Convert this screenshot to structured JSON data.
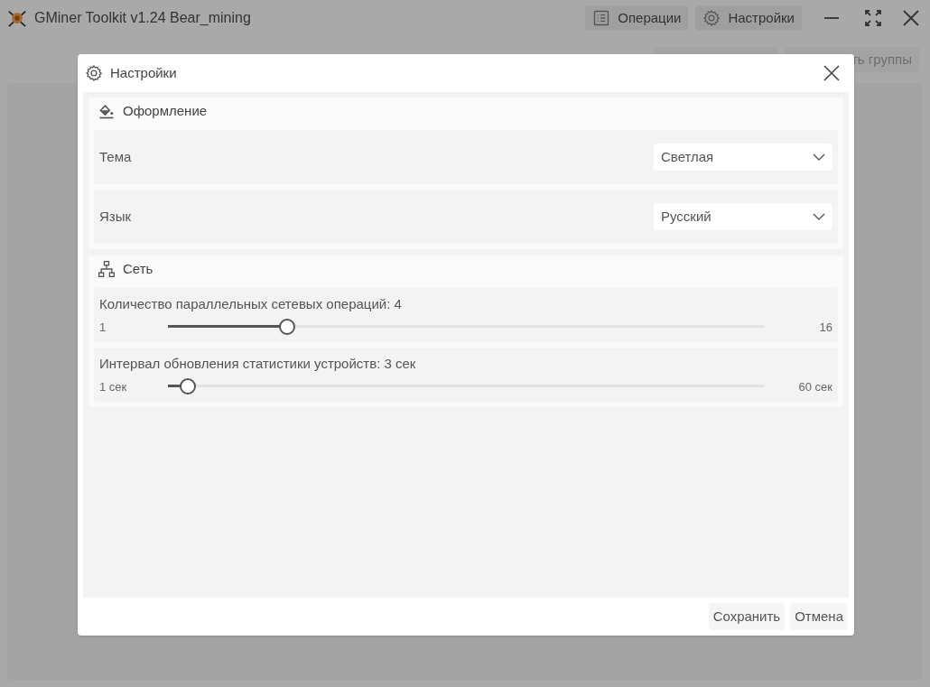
{
  "window": {
    "title": "GMiner Toolkit v1.24 Bear_mining"
  },
  "header_buttons": [
    {
      "kind": "operations",
      "label": "Операции"
    },
    {
      "kind": "settings",
      "label": "Настройки"
    }
  ],
  "toolbar": {
    "partial_button": "ть группы"
  },
  "dialog": {
    "title": "Настройки",
    "sections": [
      {
        "kind": "appearance",
        "title": "Оформление",
        "rows": [
          {
            "kind": "select",
            "label": "Тема",
            "value": "Светлая"
          },
          {
            "kind": "select",
            "label": "Язык",
            "value": "Русский"
          }
        ]
      },
      {
        "kind": "network",
        "title": "Сеть",
        "rows": [
          {
            "kind": "slider",
            "label": "Количество параллельных сетевых операций: 4",
            "min": "1",
            "max": "16",
            "level": 0.2
          },
          {
            "kind": "slider",
            "label": "Интервал обновления статистики устройств: 3 сек",
            "min": "1 сек",
            "max": "60 сек",
            "level": 0.034
          }
        ]
      }
    ],
    "buttons": [
      "Сохранить",
      "Отмена"
    ]
  }
}
